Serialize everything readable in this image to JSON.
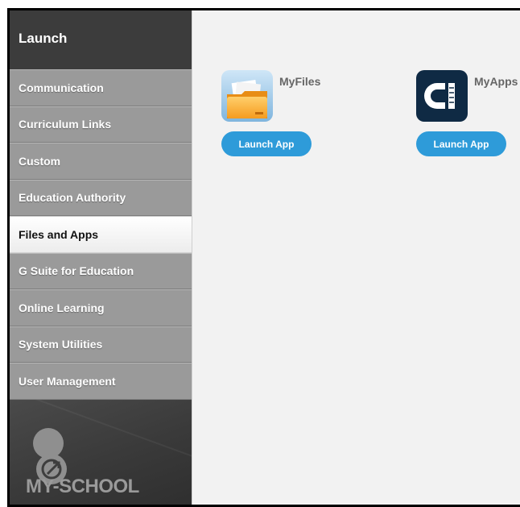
{
  "sidebar": {
    "title": "Launch",
    "items": [
      {
        "label": "Communication"
      },
      {
        "label": "Curriculum Links"
      },
      {
        "label": "Custom"
      },
      {
        "label": "Education Authority"
      },
      {
        "label": "Files and Apps"
      },
      {
        "label": "G Suite for Education"
      },
      {
        "label": "Online Learning"
      },
      {
        "label": "System Utilities"
      },
      {
        "label": "User Management"
      }
    ],
    "active_item": "Files and Apps",
    "logo_text": "MY-SCHOOL"
  },
  "apps": [
    {
      "name": "MyFiles",
      "button_label": "Launch App",
      "icon": "folder-icon"
    },
    {
      "name": "MyApps",
      "button_label": "Launch App",
      "icon": "myapps-icon"
    }
  ],
  "colors": {
    "accent": "#2e9bd9",
    "sidebar_dark": "#3b3b3b",
    "nav_item": "#9a9a9a",
    "content_bg": "#f2f2f2"
  }
}
